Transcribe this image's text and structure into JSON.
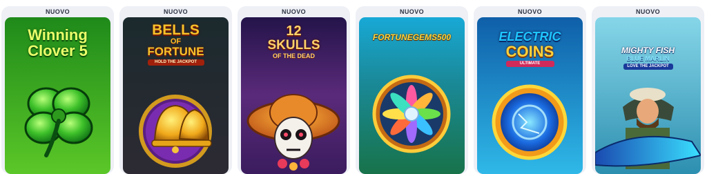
{
  "games": [
    {
      "badge": "NUOVO",
      "title_lines": [
        "Winning",
        "Clover 5"
      ],
      "icon": "four-leaf-clover-icon",
      "colors": {
        "bg_top": "#1f8a1a",
        "bg_bottom": "#5bc728",
        "title": "#eaff6a"
      }
    },
    {
      "badge": "NUOVO",
      "title_lines": [
        "BELLS",
        "OF",
        "FORTUNE"
      ],
      "subtitle": "HOLD THE JACKPOT",
      "icon": "golden-bell-icon",
      "colors": {
        "bg_top": "#1b2a2e",
        "bg_bottom": "#2d2a33",
        "title": "#f7c22a"
      }
    },
    {
      "badge": "NUOVO",
      "title_lines": [
        "12",
        "SKULLS",
        "OF THE DEAD"
      ],
      "icon": "sugar-skull-icon",
      "colors": {
        "bg_top": "#24144a",
        "bg_bottom": "#3b1c5e",
        "title": "#ffd26a"
      }
    },
    {
      "badge": "NUOVO",
      "title_lines": [
        "FORTUNEGEMS500"
      ],
      "icon": "crystal-flower-icon",
      "colors": {
        "bg_top": "#18a9d6",
        "bg_bottom": "#18734a",
        "title": "#ffd23a"
      }
    },
    {
      "badge": "NUOVO",
      "title_lines": [
        "ELECTRIC",
        "COINS"
      ],
      "subtitle": "ULTIMATE",
      "icon": "electric-coin-icon",
      "colors": {
        "bg_top": "#0f5fa8",
        "bg_bottom": "#2fb8e8",
        "title": "#1ec6ff"
      }
    },
    {
      "badge": "NUOVO",
      "title_lines": [
        "MIGHTY FISH",
        "BLUE MARLIN"
      ],
      "subtitle": "LOVE THE JACKPOT",
      "icon": "fisherman-marlin-icon",
      "colors": {
        "bg_top": "#86d6e8",
        "bg_bottom": "#2d8fb0",
        "title": "#ffffff"
      }
    }
  ]
}
